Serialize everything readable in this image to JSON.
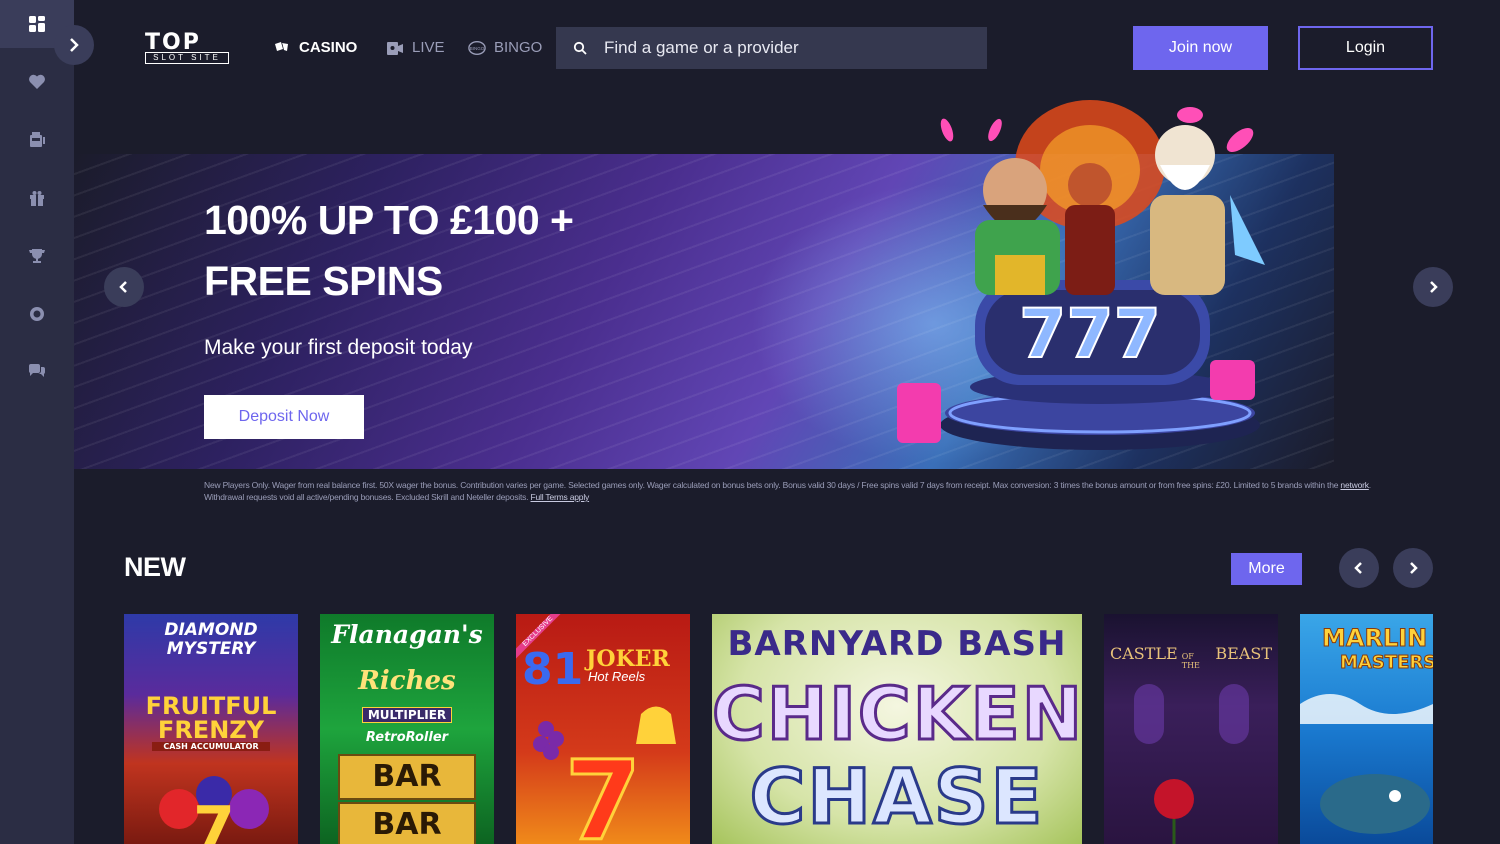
{
  "sidebar": {
    "items": [
      {
        "icon": "grid-icon",
        "active": true
      },
      {
        "icon": "heart-icon",
        "active": false
      },
      {
        "icon": "slot-machine-icon",
        "active": false
      },
      {
        "icon": "gift-icon",
        "active": false
      },
      {
        "icon": "trophy-icon",
        "active": false
      },
      {
        "icon": "lifebuoy-icon",
        "active": false
      },
      {
        "icon": "chat-icon",
        "active": false
      }
    ],
    "expand_icon": "chevron-right-icon"
  },
  "header": {
    "logo_top": "TOP",
    "logo_bottom": "SLOT SITE",
    "nav": [
      {
        "label": "CASINO",
        "icon": "cards-icon",
        "active": true
      },
      {
        "label": "LIVE",
        "icon": "live-dealer-icon",
        "active": false
      },
      {
        "label": "BINGO",
        "icon": "bingo-ball-icon",
        "active": false
      }
    ],
    "search_placeholder": "Find a game or a provider",
    "join_label": "Join now",
    "login_label": "Login"
  },
  "banner": {
    "title_line1": "100% UP TO £100 +",
    "title_line2": "FREE SPINS",
    "subtitle": "Make your first deposit today",
    "cta_label": "Deposit Now",
    "terms_text": "New Players Only. Wager from real balance first. 50X wager the bonus. Contribution varies per game. Selected games only. Wager calculated on bonus bets only. Bonus valid 30 days / Free spins valid 7 days from receipt. Max conversion: 3 times the bonus amount or from free spins: £20. Limited to 5 brands within the",
    "terms_link1": "network",
    "terms_text2": ". Withdrawal requests void all active/pending bonuses. Excluded Skrill and Neteller deposits.",
    "terms_link2": "Full Terms apply"
  },
  "new_section": {
    "title": "NEW",
    "more_label": "More",
    "games": [
      {
        "name": "Diamond Mystery Fruitful Frenzy",
        "line1": "DIAMOND",
        "line2": "MYSTERY",
        "line3": "FRUITFUL",
        "line4": "FRENZY",
        "line5": "CASH ACCUMULATOR"
      },
      {
        "name": "Flanagan's Riches",
        "line1": "Flanagan's",
        "line2": "Riches",
        "line3": "MULTIPLIER",
        "line4": "RetroRoller",
        "line5": "BAR",
        "line6": "BAR"
      },
      {
        "name": "81 Joker Hot Reels",
        "line1": "81",
        "line2": "JOKER",
        "line3": "Hot Reels",
        "badge": "EXCLUSIVE"
      },
      {
        "name": "Barnyard Bash Chicken Chase",
        "line1": "BARNYARD BASH",
        "line2": "CHICKEN",
        "line3": "CHASE"
      },
      {
        "name": "Castle of the Beast",
        "line1": "CASTLE",
        "line2": "OF THE",
        "line3": "BEAST"
      },
      {
        "name": "Marlin Masters",
        "line1": "MARLIN",
        "line2": "MASTERS"
      }
    ]
  },
  "colors": {
    "accent": "#6e66ee",
    "background": "#1b1c2b",
    "sidebar": "#2b2d44",
    "search_bg": "#35384f"
  }
}
